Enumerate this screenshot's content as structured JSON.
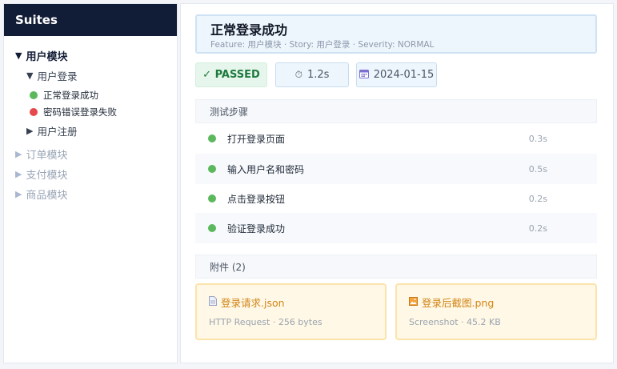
{
  "sidebar": {
    "title": "Suites",
    "open_suite": "用户模块",
    "open_story": "用户登录",
    "cases": [
      {
        "name": "正常登录成功",
        "status": "passed"
      },
      {
        "name": "密码错误登录失败",
        "status": "failed"
      }
    ],
    "closed_story": "用户注册",
    "closed_suites": [
      "订单模块",
      "支付模块",
      "商品模块"
    ]
  },
  "test": {
    "title": "正常登录成功",
    "subtitle": "Feature: 用户模块 · Story: 用户登录 · Severity: NORMAL",
    "status_label": "✓ PASSED",
    "duration": "1.2s",
    "date": "2024-01-15"
  },
  "steps": {
    "header": "测试步骤",
    "items": [
      {
        "name": "打开登录页面",
        "time": "0.3s"
      },
      {
        "name": "输入用户名和密码",
        "time": "0.5s"
      },
      {
        "name": "点击登录按钮",
        "time": "0.2s"
      },
      {
        "name": "验证登录成功",
        "time": "0.2s"
      }
    ]
  },
  "attachments": {
    "header": "附件 (2)",
    "items": [
      {
        "name": "登录请求.json",
        "meta": "HTTP Request · 256 bytes",
        "icon": "document-icon"
      },
      {
        "name": "登录后截图.png",
        "meta": "Screenshot · 45.2 KB",
        "icon": "image-icon"
      }
    ]
  },
  "colors": {
    "sidebar_header": "#111c36",
    "passed": "#5cb85c",
    "failed": "#e5484d",
    "attachment_text": "#d18416"
  }
}
